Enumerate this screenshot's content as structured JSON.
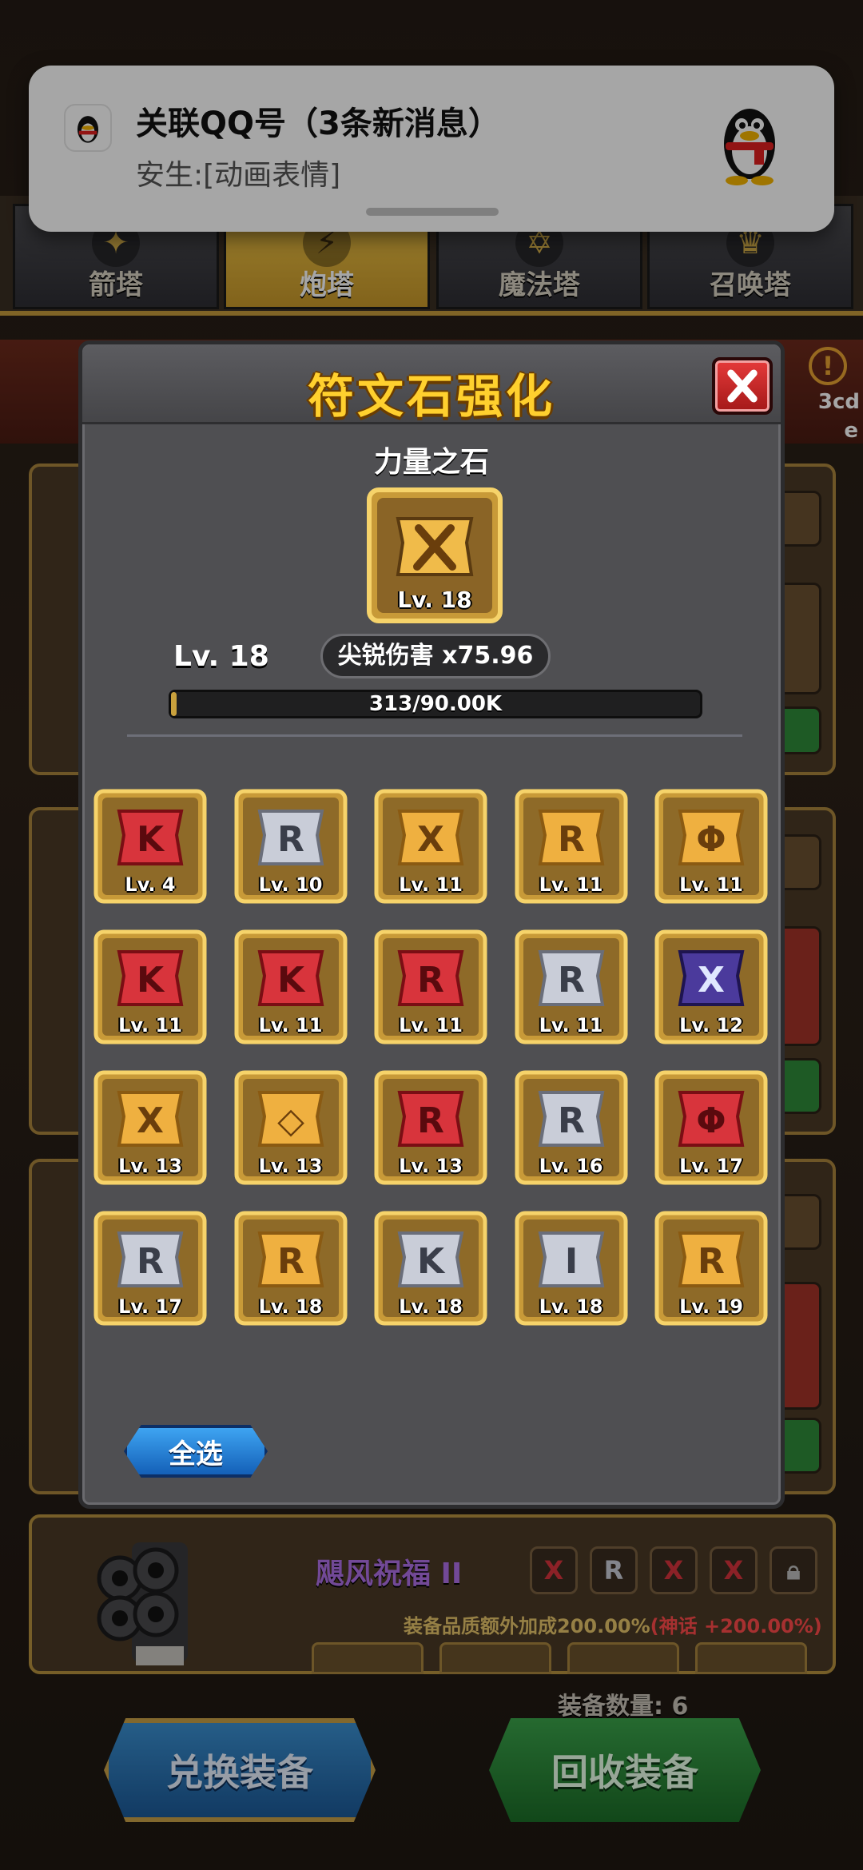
{
  "tabs": [
    {
      "label": "箭塔",
      "icon": "arrow-tower-icon",
      "active": false
    },
    {
      "label": "炮塔",
      "icon": "cannon-tower-icon",
      "active": true
    },
    {
      "label": "魔法塔",
      "icon": "magic-tower-icon",
      "active": false
    },
    {
      "label": "召唤塔",
      "icon": "summon-tower-icon",
      "active": false
    }
  ],
  "notification": {
    "title": "关联QQ号（3条新消息）",
    "body": "安生:[动画表情]",
    "app_icon": "qq-penguin-icon"
  },
  "background": {
    "alert_text_1": "3cd",
    "alert_text_2": "e",
    "bottom_card": {
      "title": "飓风祝福 II",
      "desc_prefix": "装备品质额外加成200.00%",
      "desc_highlight": "(神话 +200.00%)"
    },
    "equip_count": "装备数量: 6",
    "exchange_label": "兑换装备",
    "recycle_label": "回收装备"
  },
  "modal": {
    "title": "符文石强化",
    "rune_name": "力量之石",
    "rune_level_badge": "Lv. 18",
    "level_text": "Lv. 18",
    "stat_text": "尖锐伤害 x75.96",
    "xp_text": "313/90.00K",
    "xp_fraction": 0.0035,
    "select_all_label": "全选",
    "runes": [
      {
        "level": "Lv. 4",
        "color": "red",
        "glyph": "K"
      },
      {
        "level": "Lv. 10",
        "color": "silver",
        "glyph": "R"
      },
      {
        "level": "Lv. 11",
        "color": "gold",
        "glyph": "X"
      },
      {
        "level": "Lv. 11",
        "color": "gold",
        "glyph": "R"
      },
      {
        "level": "Lv. 11",
        "color": "gold",
        "glyph": "Φ"
      },
      {
        "level": "Lv. 11",
        "color": "red",
        "glyph": "K"
      },
      {
        "level": "Lv. 11",
        "color": "red",
        "glyph": "K"
      },
      {
        "level": "Lv. 11",
        "color": "red",
        "glyph": "R"
      },
      {
        "level": "Lv. 11",
        "color": "silver",
        "glyph": "R"
      },
      {
        "level": "Lv. 12",
        "color": "purple",
        "glyph": "X"
      },
      {
        "level": "Lv. 13",
        "color": "gold",
        "glyph": "X"
      },
      {
        "level": "Lv. 13",
        "color": "gold",
        "glyph": "◇"
      },
      {
        "level": "Lv. 13",
        "color": "red",
        "glyph": "R"
      },
      {
        "level": "Lv. 16",
        "color": "silver",
        "glyph": "R"
      },
      {
        "level": "Lv. 17",
        "color": "red",
        "glyph": "Φ"
      },
      {
        "level": "Lv. 17",
        "color": "silver",
        "glyph": "R"
      },
      {
        "level": "Lv. 18",
        "color": "gold",
        "glyph": "R"
      },
      {
        "level": "Lv. 18",
        "color": "silver",
        "glyph": "K"
      },
      {
        "level": "Lv. 18",
        "color": "silver",
        "glyph": "I"
      },
      {
        "level": "Lv. 19",
        "color": "gold",
        "glyph": "R"
      }
    ]
  },
  "colors": {
    "gold_frame": "#f1c24a",
    "red_rune": "#d8343c",
    "silver_rune": "#c9cdd8",
    "gold_rune": "#e9a83a",
    "purple_rune": "#4b3a9c",
    "title_yellow": "#ffd02e"
  }
}
